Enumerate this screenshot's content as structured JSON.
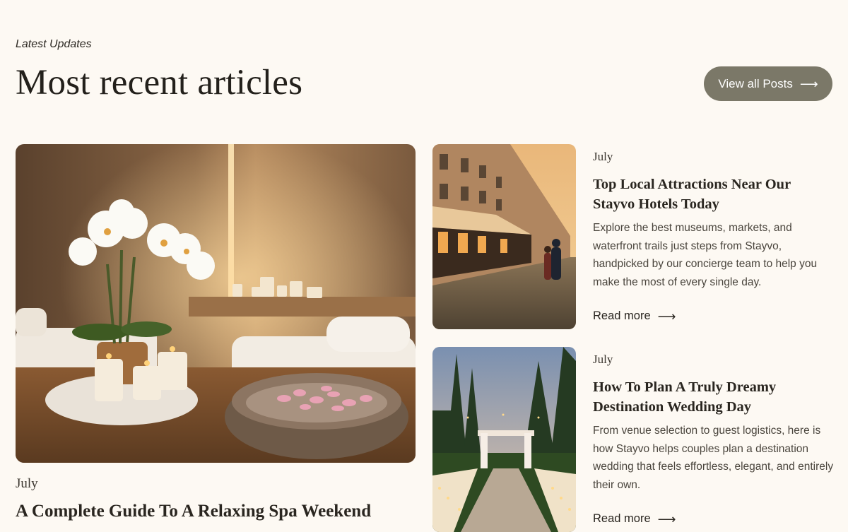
{
  "header": {
    "eyebrow": "Latest Updates",
    "title": "Most recent articles",
    "view_all_label": "View all Posts"
  },
  "featured": {
    "date": "July",
    "title": "A Complete Guide To A Relaxing Spa Weekend"
  },
  "articles": [
    {
      "date": "July",
      "title": "Top Local Attractions Near Our Stayvo Hotels Today",
      "excerpt": "Explore the best museums, markets, and waterfront trails just steps from Stayvo, handpicked by our concierge team to help you make the most of every single day.",
      "read_more": "Read more"
    },
    {
      "date": "July",
      "title": "How To Plan A Truly Dreamy Destination Wedding Day",
      "excerpt": "From venue selection to guest logistics, here is how Stayvo helps couples plan a destination wedding that feels effortless, elegant, and entirely their own.",
      "read_more": "Read more"
    }
  ],
  "icons": {
    "arrow": "arrow-right-icon"
  },
  "colors": {
    "background": "#fdf9f3",
    "button": "#7b7868",
    "text": "#2a2620"
  }
}
